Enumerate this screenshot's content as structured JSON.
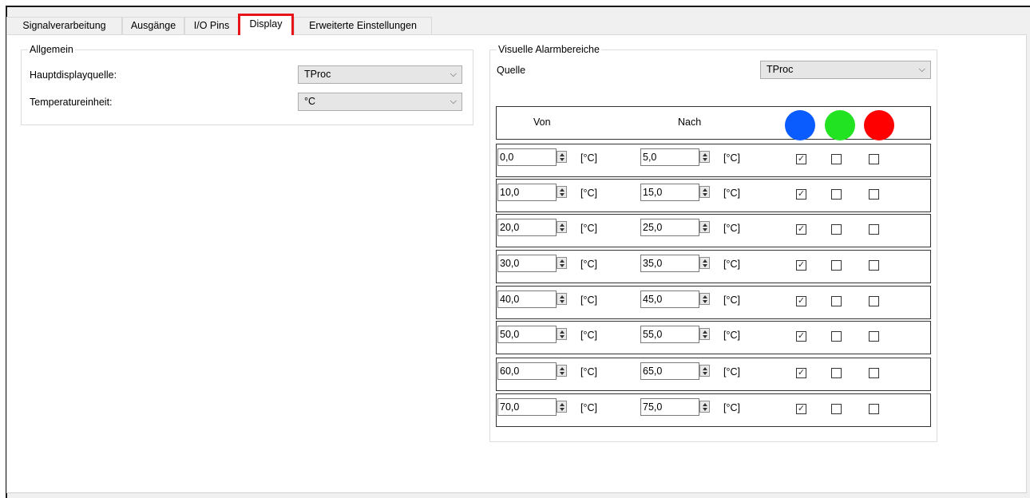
{
  "tabs": [
    {
      "label": "Signalverarbeitung"
    },
    {
      "label": "Ausgänge"
    },
    {
      "label": "I/O Pins"
    },
    {
      "label": "Display"
    },
    {
      "label": "Erweiterte Einstellungen"
    }
  ],
  "active_tab": "Display",
  "highlight_color": "#e8141a",
  "general": {
    "title": "Allgemein",
    "main_display_source_label": "Hauptdisplayquelle:",
    "main_display_source_value": "TProc",
    "temperature_unit_label": "Temperatureinheit:",
    "temperature_unit_value": "°C"
  },
  "alarm": {
    "title": "Visuelle Alarmbereiche",
    "source_label": "Quelle",
    "source_value": "TProc",
    "col_from": "Von",
    "col_to": "Nach",
    "colors": [
      "#0a5cff",
      "#21e321",
      "#ff0000"
    ],
    "unit": "[°C]",
    "rows": [
      {
        "from": "0,0",
        "to": "5,0",
        "blue": true,
        "green": false,
        "red": false
      },
      {
        "from": "10,0",
        "to": "15,0",
        "blue": true,
        "green": false,
        "red": false
      },
      {
        "from": "20,0",
        "to": "25,0",
        "blue": true,
        "green": false,
        "red": false
      },
      {
        "from": "30,0",
        "to": "35,0",
        "blue": true,
        "green": false,
        "red": false
      },
      {
        "from": "40,0",
        "to": "45,0",
        "blue": true,
        "green": false,
        "red": false
      },
      {
        "from": "50,0",
        "to": "55,0",
        "blue": true,
        "green": false,
        "red": false
      },
      {
        "from": "60,0",
        "to": "65,0",
        "blue": true,
        "green": false,
        "red": false
      },
      {
        "from": "70,0",
        "to": "75,0",
        "blue": true,
        "green": false,
        "red": false
      }
    ]
  }
}
